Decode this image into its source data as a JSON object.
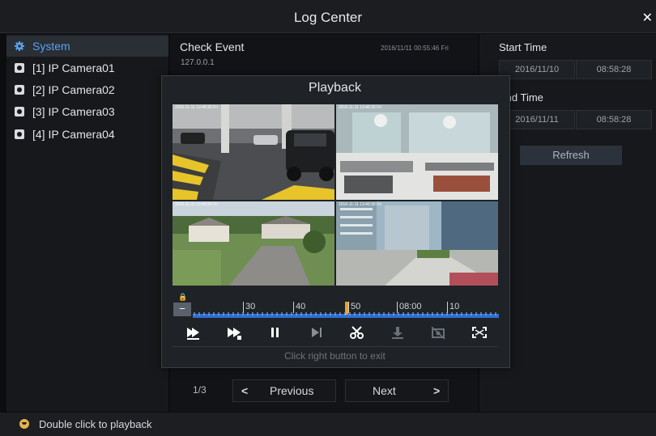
{
  "window": {
    "title": "Log Center",
    "close_icon": "close-icon"
  },
  "tree": {
    "items": [
      {
        "label": "System",
        "icon": "gear-icon",
        "selected": true
      },
      {
        "label": "[1] IP Camera01",
        "icon": "camera-icon",
        "selected": false
      },
      {
        "label": "[2] IP Camera02",
        "icon": "camera-icon",
        "selected": false
      },
      {
        "label": "[3] IP Camera03",
        "icon": "camera-icon",
        "selected": false
      },
      {
        "label": "[4] IP Camera04",
        "icon": "camera-icon",
        "selected": false
      }
    ]
  },
  "event": {
    "title": "Check Event",
    "ip": "127.0.0.1",
    "time": "2016/11/11 00:55:46 Fri"
  },
  "filter": {
    "start_label": "Start Time",
    "start_date": "2016/11/10",
    "start_time": "08:58:28",
    "end_label": "End Time",
    "end_date": "2016/11/11",
    "end_time": "08:58:28",
    "refresh_label": "Refresh"
  },
  "pagination": {
    "indicator": "1/3",
    "prev_label": "Previous",
    "next_label": "Next"
  },
  "status": {
    "text": "Double click to playback"
  },
  "playback": {
    "title": "Playback",
    "osd_text": "2016-11-11 13:46:30 Fri",
    "timeline_labels": [
      "30",
      "40",
      "50",
      "08:00",
      "10"
    ],
    "controls": [
      "slow-play-icon",
      "fast-forward-icon",
      "pause-icon",
      "step-next-icon",
      "clip-icon",
      "download-icon",
      "snapshot-icon",
      "fullscreen-icon"
    ],
    "exit_hint": "Click right button to exit"
  },
  "colors": {
    "accent": "#5aa2ee",
    "timeline": "#2d6fd4",
    "cursor": "#f0a020"
  }
}
